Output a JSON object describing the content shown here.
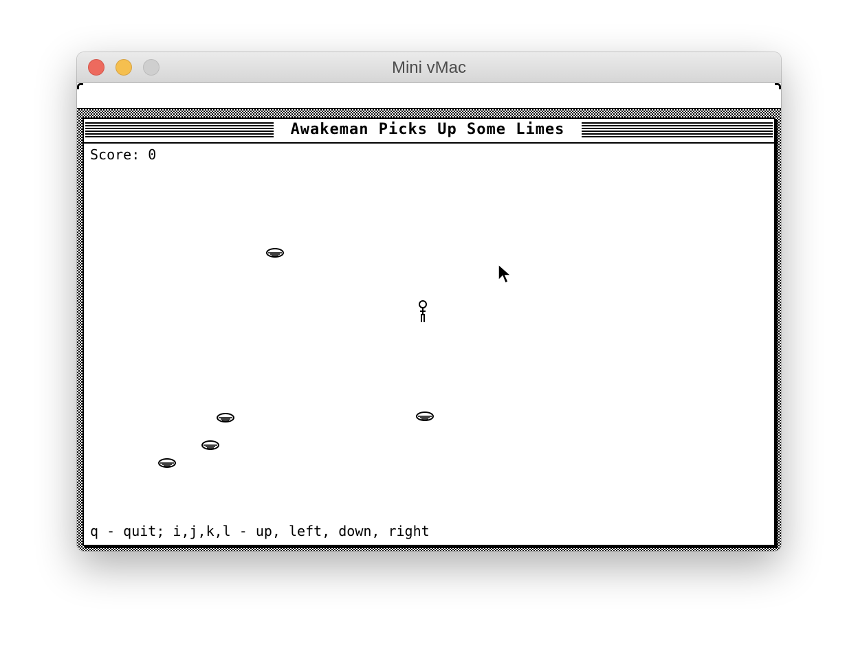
{
  "host_window": {
    "title": "Mini vMac"
  },
  "game_window": {
    "title": "Awakeman Picks Up Some Limes",
    "score_label": "Score: 0",
    "help_text": "q - quit; i,j,k,l - up, left, down, right"
  },
  "sprites": {
    "player": "stick-figure",
    "lime": "lime",
    "lime_count": 5
  },
  "colors": {
    "close": "#ed6a5e",
    "minimize": "#f5bf4f",
    "zoom": "#cfcfcf",
    "screen_ink": "#000000",
    "screen_paper": "#ffffff"
  }
}
